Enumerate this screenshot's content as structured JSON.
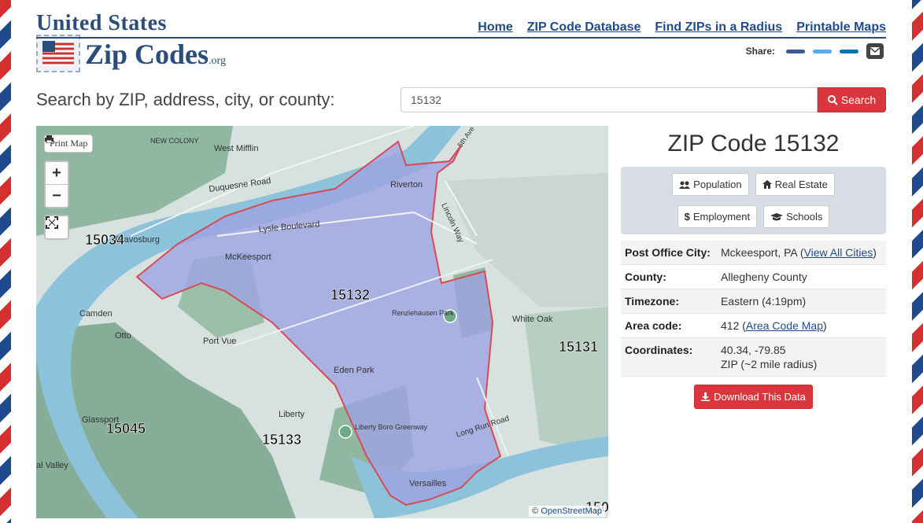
{
  "logo": {
    "line1": "United States",
    "line2": "Zip Codes",
    "suffix": ".org"
  },
  "nav": [
    "Home",
    "ZIP Code Database",
    "Find ZIPs in a Radius",
    "Printable Maps"
  ],
  "share": {
    "label": "Share:",
    "colors": [
      "#3b5998",
      "#55acee",
      "#0077b5"
    ]
  },
  "search": {
    "label": "Search by ZIP, address, city, or county:",
    "value": "15132",
    "button": "Search"
  },
  "map": {
    "print_label": "Print Map",
    "zoom_in": "+",
    "zoom_out": "−",
    "attribution_prefix": "©",
    "attribution_link": "OpenStreetMap",
    "zip_labels": [
      "15034",
      "15132",
      "15131",
      "15045",
      "15133",
      "150"
    ],
    "place_labels": [
      "West Mifflin",
      "NEW COLONY",
      "Duquesne Road",
      "Riverton",
      "Lysle Boulevard",
      "McKeesport",
      "Renziehausen Park",
      "White Oak",
      "Camden",
      "Otto",
      "Port Vue",
      "Eden Park",
      "Glassport",
      "Liberty",
      "Liberty Boro Greenway",
      "Long Run Road",
      "Versailles",
      "al Valley",
      "5th Ave",
      "Lincoln Way",
      "Dravosburg"
    ]
  },
  "info": {
    "title": "ZIP Code 15132",
    "buttons": [
      "Population",
      "Real Estate",
      "Employment",
      "Schools"
    ],
    "rows": [
      {
        "key": "Post Office City:",
        "value": "Mckeesport, PA (",
        "link": "View All Cities",
        "after": ")"
      },
      {
        "key": "County:",
        "value": "Allegheny County"
      },
      {
        "key": "Timezone:",
        "value": "Eastern (4:19pm)"
      },
      {
        "key": "Area code:",
        "value": "412 (",
        "link": "Area Code Map",
        "after": ")"
      },
      {
        "key": "Coordinates:",
        "value": "40.34, -79.85",
        "value2": "ZIP (~2 mile radius)"
      }
    ],
    "download": "Download This Data"
  }
}
